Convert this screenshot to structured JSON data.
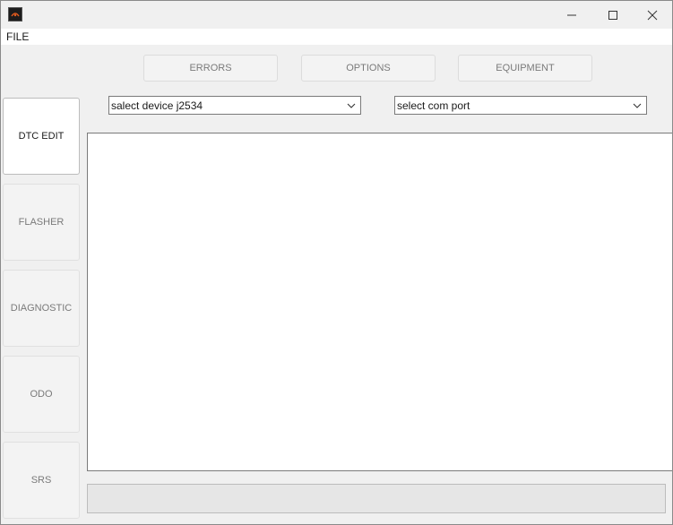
{
  "menu": {
    "file_label": "FILE"
  },
  "top_tabs": {
    "errors": "ERRORS",
    "options": "OPTIONS",
    "equipment": "EQUIPMENT"
  },
  "sidebar": {
    "items": [
      {
        "label": "DTC EDIT",
        "active": true
      },
      {
        "label": "FLASHER",
        "active": false
      },
      {
        "label": "DIAGNOSTIC",
        "active": false
      },
      {
        "label": "ODO",
        "active": false
      },
      {
        "label": "SRS",
        "active": false
      }
    ]
  },
  "device_select": {
    "value": "salect device j2534"
  },
  "port_select": {
    "value": "select com port"
  },
  "icons": {
    "app": "app-icon",
    "minimize": "minimize-icon",
    "maximize": "maximize-icon",
    "close": "close-icon",
    "dropdown": "chevron-down-icon"
  }
}
